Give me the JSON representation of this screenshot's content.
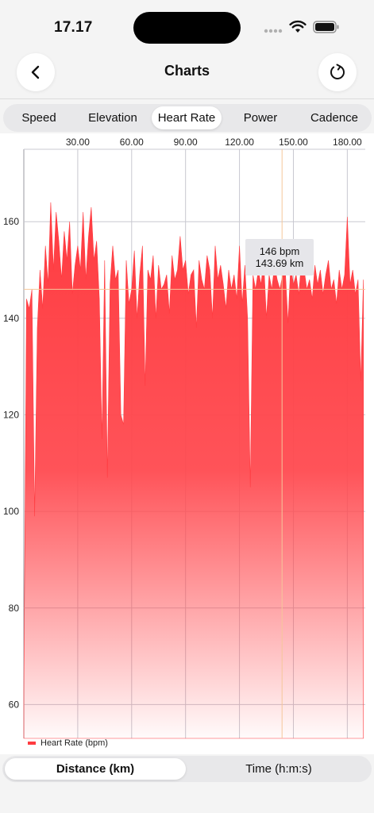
{
  "status_bar": {
    "time": "17.17"
  },
  "nav": {
    "title": "Charts",
    "back_icon": "chevron-left-icon",
    "refresh_icon": "refresh-icon"
  },
  "metric_tabs": {
    "items": [
      "Speed",
      "Elevation",
      "Heart Rate",
      "Power",
      "Cadence"
    ],
    "selected": "Heart Rate"
  },
  "axis_tabs": {
    "items": [
      "Distance (km)",
      "Time (h:m:s)"
    ],
    "selected": "Distance (km)"
  },
  "tooltip": {
    "value": "146 bpm",
    "distance": "143.69 km"
  },
  "colors": {
    "series": "#ff3b40",
    "crosshair": "#f5c79a",
    "grid": "#c8c8d0"
  },
  "chart_data": {
    "type": "area",
    "legend": [
      "Heart Rate (bpm)"
    ],
    "xlim": [
      0,
      190
    ],
    "ylim": [
      53,
      175
    ],
    "x_ticks": [
      "30.00",
      "60.00",
      "90.00",
      "120.00",
      "150.00",
      "180.00"
    ],
    "y_ticks": [
      "60",
      "80",
      "100",
      "120",
      "140",
      "160"
    ],
    "x_tick_values": [
      30,
      60,
      90,
      120,
      150,
      180
    ],
    "y_tick_values": [
      60,
      80,
      100,
      120,
      140,
      160
    ],
    "crosshair": {
      "x": 143.69,
      "y": 146
    },
    "series": [
      {
        "name": "Heart Rate (bpm)",
        "x": [
          0,
          1.5,
          3,
          4.5,
          6,
          7.5,
          9,
          10.5,
          12,
          13.5,
          15,
          16.5,
          18,
          19.5,
          21,
          22.5,
          24,
          25.5,
          27,
          28.5,
          30,
          31.5,
          33,
          34.5,
          36,
          37.5,
          39,
          40.5,
          42,
          43.5,
          45,
          46.5,
          48,
          49.5,
          51,
          52.5,
          54,
          55.5,
          57,
          58.5,
          60,
          61.5,
          63,
          64.5,
          66,
          67.5,
          69,
          70.5,
          72,
          73.5,
          75,
          76.5,
          78,
          79.5,
          81,
          82.5,
          84,
          85.5,
          87,
          88.5,
          90,
          91.5,
          93,
          94.5,
          96,
          97.5,
          99,
          100.5,
          102,
          103.5,
          105,
          106.5,
          108,
          109.5,
          111,
          112.5,
          114,
          115.5,
          117,
          118.5,
          120,
          121.5,
          123,
          124.5,
          126,
          127.5,
          129,
          130.5,
          132,
          133.5,
          135,
          136.5,
          138,
          139.5,
          141,
          142.5,
          144,
          145.5,
          147,
          148.5,
          150,
          151.5,
          153,
          154.5,
          156,
          157.5,
          159,
          160.5,
          162,
          163.5,
          165,
          166.5,
          168,
          169.5,
          171,
          172.5,
          174,
          175.5,
          177,
          178.5,
          180,
          181.5,
          183,
          184.5,
          186,
          187.5,
          189
        ],
        "values": [
          63,
          144,
          142,
          146,
          99,
          138,
          150,
          142,
          155,
          147,
          164,
          150,
          162,
          156,
          148,
          158,
          152,
          160,
          145,
          151,
          155,
          150,
          162,
          148,
          157,
          163,
          152,
          156,
          144,
          115,
          152,
          107,
          147,
          155,
          148,
          150,
          120,
          118,
          152,
          143,
          146,
          154,
          140,
          149,
          155,
          126,
          150,
          148,
          153,
          140,
          151,
          146,
          147,
          149,
          141,
          153,
          148,
          150,
          157,
          150,
          152,
          145,
          149,
          150,
          138,
          152,
          148,
          146,
          153,
          150,
          140,
          155,
          148,
          151,
          147,
          142,
          150,
          146,
          149,
          144,
          155,
          143,
          151,
          140,
          105,
          149,
          146,
          150,
          147,
          152,
          140,
          149,
          146,
          151,
          148,
          146,
          149,
          150,
          139,
          151,
          147,
          149,
          145,
          152,
          150,
          146,
          148,
          144,
          151,
          147,
          150,
          145,
          149,
          152,
          146,
          148,
          143,
          150,
          146,
          149,
          161,
          147,
          150,
          145,
          148,
          127,
          148
        ]
      }
    ]
  }
}
